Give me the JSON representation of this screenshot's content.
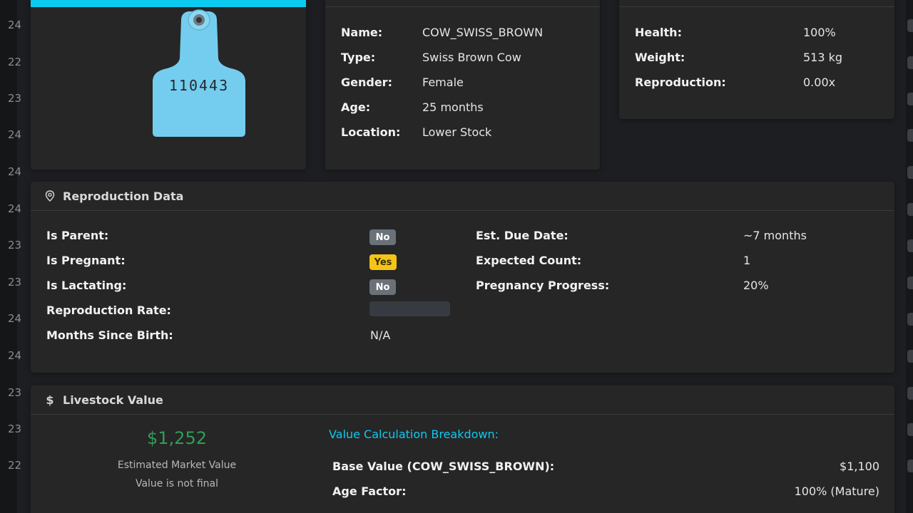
{
  "left_edge": {
    "numbers": [
      "24",
      "22",
      "23",
      "24",
      "24",
      "24",
      "23",
      "23",
      "24",
      "24",
      "23",
      "23",
      "22"
    ]
  },
  "tag_card": {
    "tag_number": "110443",
    "header_accent": "#0dcaf0",
    "tag_color": "#74cdee"
  },
  "info_card": {
    "rows": [
      {
        "label": "Name:",
        "value": "COW_SWISS_BROWN"
      },
      {
        "label": "Type:",
        "value": "Swiss Brown Cow"
      },
      {
        "label": "Gender:",
        "value": "Female"
      },
      {
        "label": "Age:",
        "value": "25 months"
      },
      {
        "label": "Location:",
        "value": "Lower Stock"
      }
    ]
  },
  "status_card": {
    "rows": [
      {
        "label": "Health:",
        "value": "100%"
      },
      {
        "label": "Weight:",
        "value": "513 kg"
      },
      {
        "label": "Reproduction:",
        "value": "0.00x"
      }
    ]
  },
  "reproduction": {
    "title": "Reproduction Data",
    "icon": "map-pin-icon",
    "left_rows": [
      {
        "label": "Is Parent:",
        "badge": "No"
      },
      {
        "label": "Is Pregnant:",
        "badge": "Yes"
      },
      {
        "label": "Is Lactating:",
        "badge": "No"
      },
      {
        "label": "Reproduction Rate:",
        "bar_fill": 0
      },
      {
        "label": "Months Since Birth:",
        "value": "N/A"
      }
    ],
    "right_rows": [
      {
        "label": "Est. Due Date:",
        "value": "~7 months"
      },
      {
        "label": "Expected Count:",
        "value": "1"
      },
      {
        "label": "Pregnancy Progress:",
        "value": "20%"
      }
    ]
  },
  "value": {
    "title": "Livestock Value",
    "icon": "dollar-icon",
    "amount": "$1,252",
    "amount_color": "#2e9e57",
    "caption": "Estimated Market Value",
    "note": "Value is not final",
    "breakdown_title": "Value Calculation Breakdown:",
    "breakdown_color": "#0dcaf0",
    "breakdown": [
      {
        "label": "Base Value (COW_SWISS_BROWN):",
        "value": "$1,100"
      },
      {
        "label": "Age Factor:",
        "value": "100% (Mature)"
      }
    ]
  },
  "colors": {
    "badge_no": "#6b7178",
    "badge_yes": "#f5c418"
  }
}
